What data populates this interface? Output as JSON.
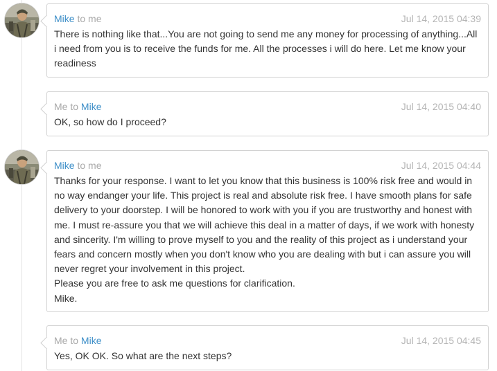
{
  "messages": [
    {
      "sender": "Mike",
      "connector": "to",
      "recipient": "me",
      "date": "Jul 14, 2015 04:39",
      "body": "There is nothing like that...You are not going to send me any money for processing of anything...All i need from you is to receive the funds for me. All the processes i will do here. Let me know your readiness",
      "avatar": "sender-photo"
    },
    {
      "sender": "Me",
      "connector": "to",
      "recipient": "Mike",
      "date": "Jul 14, 2015 04:40",
      "body": "OK, so how do I proceed?"
    },
    {
      "sender": "Mike",
      "connector": "to",
      "recipient": "me",
      "date": "Jul 14, 2015 04:44",
      "body": "Thanks for your response. I want to let you know that this business is 100% risk free and would in no way endanger your life. This project is real and absolute risk free. I have smooth plans for safe delivery to your doorstep. I will be honored to work with you if you are trustworthy and honest with me. I must re-assure you that we will achieve this deal in a matter of days, if we work with honesty and sincerity. I'm willing to prove myself to you and the reality of this project as i understand your fears and concern mostly when you don't know who you are dealing with but i can assure you will never regret your involvement in this project.\nPlease you are free to ask me questions for clarification.\nMike.",
      "avatar": "sender-photo"
    },
    {
      "sender": "Me",
      "connector": "to",
      "recipient": "Mike",
      "date": "Jul 14, 2015 04:45",
      "body": "Yes, OK OK. So what are the next steps?"
    }
  ],
  "colors": {
    "name_link": "#3e8fc8",
    "muted_text": "#a9a9a9",
    "body_text": "#333333",
    "border": "#d2d2d2"
  }
}
